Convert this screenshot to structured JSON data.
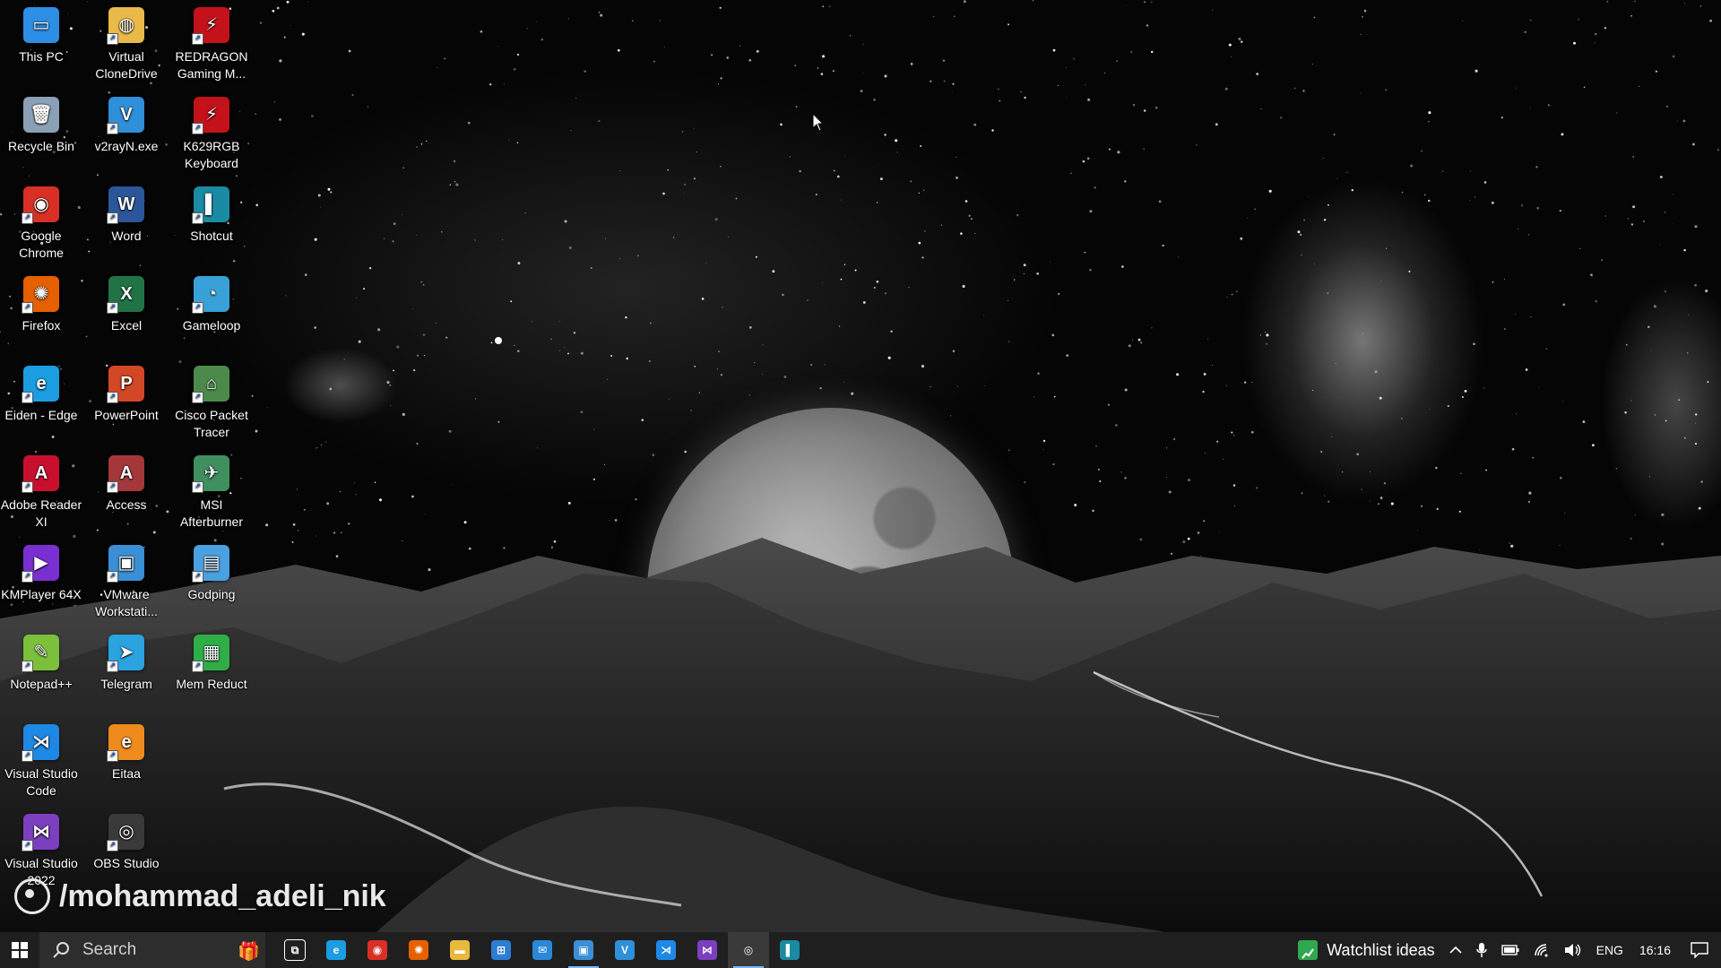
{
  "desktop": {
    "icons": [
      {
        "label": "This PC",
        "icon": "computer-icon",
        "color": "#2d8ee6",
        "glyph": "▭"
      },
      {
        "label": "Recycle Bin",
        "icon": "recycle-bin-icon",
        "color": "#8aa0b4",
        "glyph": "🗑"
      },
      {
        "label": "Google Chrome",
        "icon": "chrome-icon",
        "color": "#d93025",
        "glyph": "◉"
      },
      {
        "label": "Firefox",
        "icon": "firefox-icon",
        "color": "#e66000",
        "glyph": "✺"
      },
      {
        "label": "Eiden - Edge",
        "icon": "edge-icon",
        "color": "#1b9de2",
        "glyph": "e"
      },
      {
        "label": "Adobe Reader XI",
        "icon": "adobe-reader-icon",
        "color": "#c8102e",
        "glyph": "A"
      },
      {
        "label": "KMPlayer 64X",
        "icon": "kmplayer-icon",
        "color": "#7a2fd0",
        "glyph": "▶"
      },
      {
        "label": "Notepad++",
        "icon": "notepad-plus-plus-icon",
        "color": "#7bbf3a",
        "glyph": "✎"
      },
      {
        "label": "Visual Studio Code",
        "icon": "vscode-icon",
        "color": "#1e88e5",
        "glyph": "⋊"
      },
      {
        "label": "Visual Studio 2022",
        "icon": "visual-studio-icon",
        "color": "#7b3fbf",
        "glyph": "⋈"
      },
      {
        "label": "Virtual CloneDrive",
        "icon": "clonedrive-icon",
        "color": "#e9b949",
        "glyph": "◍"
      },
      {
        "label": "v2rayN.exe",
        "icon": "v2rayn-icon",
        "color": "#2f8fd8",
        "glyph": "V"
      },
      {
        "label": "Word",
        "icon": "word-icon",
        "color": "#2b579a",
        "glyph": "W"
      },
      {
        "label": "Excel",
        "icon": "excel-icon",
        "color": "#217346",
        "glyph": "X"
      },
      {
        "label": "PowerPoint",
        "icon": "powerpoint-icon",
        "color": "#d24726",
        "glyph": "P"
      },
      {
        "label": "Access",
        "icon": "access-icon",
        "color": "#a4373a",
        "glyph": "A"
      },
      {
        "label": "VMware Workstati...",
        "icon": "vmware-icon",
        "color": "#3a8fd6",
        "glyph": "▣"
      },
      {
        "label": "Telegram",
        "icon": "telegram-icon",
        "color": "#2aa3df",
        "glyph": "➤"
      },
      {
        "label": "Eitaa",
        "icon": "eitaa-icon",
        "color": "#ef8a1d",
        "glyph": "e"
      },
      {
        "label": "OBS Studio",
        "icon": "obs-studio-icon",
        "color": "#3a3a3a",
        "glyph": "◎"
      },
      {
        "label": "REDRAGON Gaming M...",
        "icon": "redragon-icon",
        "color": "#c4121a",
        "glyph": "⚡"
      },
      {
        "label": "K629RGB Keyboard",
        "icon": "redragon-keyboard-icon",
        "color": "#c4121a",
        "glyph": "⚡"
      },
      {
        "label": "Shotcut",
        "icon": "shotcut-icon",
        "color": "#1b8aa3",
        "glyph": "▌"
      },
      {
        "label": "Gameloop",
        "icon": "gameloop-icon",
        "color": "#3aa0d8",
        "glyph": "◔"
      },
      {
        "label": "Cisco Packet Tracer",
        "icon": "packet-tracer-icon",
        "color": "#4c8a4c",
        "glyph": "⌂"
      },
      {
        "label": "MSI Afterburner",
        "icon": "msi-afterburner-icon",
        "color": "#3f8f5f",
        "glyph": "✈"
      },
      {
        "label": "Godping",
        "icon": "godping-icon",
        "color": "#4aa0e0",
        "glyph": "▤"
      },
      {
        "label": "Mem Reduct",
        "icon": "mem-reduct-icon",
        "color": "#2fae48",
        "glyph": "▦"
      }
    ],
    "watermark": "/mohammad_adeli_nik"
  },
  "taskbar": {
    "search_label": "Search",
    "pinned": [
      {
        "icon": "task-view-icon",
        "color": "#1f1f1f",
        "glyph": "⧉"
      },
      {
        "icon": "edge-icon",
        "color": "#1b9de2",
        "glyph": "e"
      },
      {
        "icon": "chrome-icon",
        "color": "#d93025",
        "glyph": "◉"
      },
      {
        "icon": "firefox-icon",
        "color": "#e66000",
        "glyph": "✺"
      },
      {
        "icon": "file-explorer-icon",
        "color": "#e8b93a",
        "glyph": "▬"
      },
      {
        "icon": "microsoft-store-icon",
        "color": "#2d7dd2",
        "glyph": "⊞"
      },
      {
        "icon": "mail-icon",
        "color": "#2b88d8",
        "glyph": "✉"
      },
      {
        "icon": "vmware-icon",
        "color": "#3a8fd6",
        "glyph": "▣"
      },
      {
        "icon": "v2rayn-icon",
        "color": "#2f8fd8",
        "glyph": "V"
      },
      {
        "icon": "vscode-icon",
        "color": "#1e88e5",
        "glyph": "⋊"
      },
      {
        "icon": "visual-studio-icon",
        "color": "#7b3fbf",
        "glyph": "⋈"
      },
      {
        "icon": "obs-studio-icon",
        "color": "#3a3a3a",
        "glyph": "◎"
      },
      {
        "icon": "shotcut-icon",
        "color": "#1b8aa3",
        "glyph": "▌"
      }
    ],
    "widget_label": "Watchlist ideas",
    "language": "ENG",
    "time": "16:16"
  }
}
